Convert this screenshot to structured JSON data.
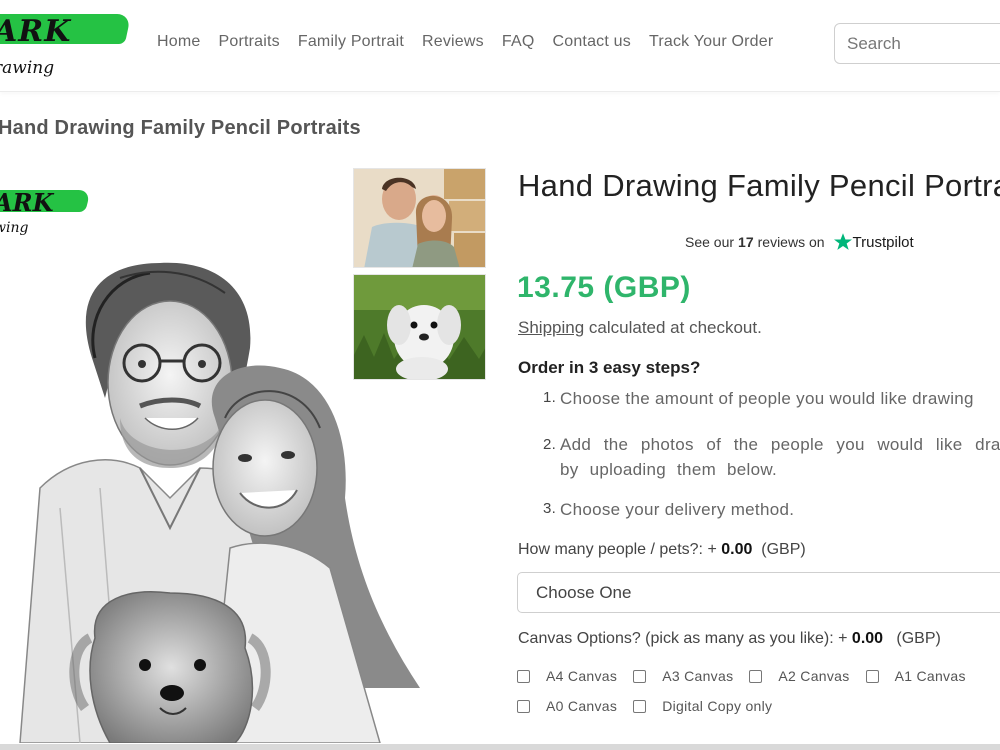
{
  "header": {
    "logo": {
      "word1": "ARK",
      "word2": "rawing"
    },
    "nav": [
      "Home",
      "Portraits",
      "Family Portrait",
      "Reviews",
      "FAQ",
      "Contact us",
      "Track Your Order"
    ],
    "search_placeholder": "Search"
  },
  "page_title": "Hand Drawing Family Pencil Portraits",
  "product": {
    "title": "Hand Drawing Family Pencil Portraits",
    "watermark": {
      "word1": "ARK",
      "word2": "wing"
    },
    "reviews": {
      "prefix": "See our",
      "count": "17",
      "suffix": "reviews on",
      "brand": "Trustpilot"
    },
    "price": "13.75  (GBP)",
    "shipping_link": "Shipping",
    "shipping_text": " calculated at checkout.",
    "steps_title": "Order in 3 easy steps?",
    "steps": [
      {
        "num": "1.",
        "text": "Choose the amount of people you would like drawing"
      },
      {
        "num": "2.",
        "text": "Add the photos of the people you would like drawn by uploading them below."
      },
      {
        "num": "3.",
        "text": "Choose your delivery method."
      }
    ],
    "people_option": {
      "label": "How many people / pets?: + ",
      "amount": "0.00",
      "currency": "  (GBP)"
    },
    "select_value": "Choose One",
    "canvas_option": {
      "label": "Canvas Options? (pick as many as you like): + ",
      "amount": "0.00",
      "currency": "   (GBP)"
    },
    "canvas_choices": [
      "A4 Canvas",
      "A3 Canvas",
      "A2 Canvas",
      "A1 Canvas",
      "A0 Canvas",
      "Digital Copy only"
    ]
  },
  "colors": {
    "brand_green": "#25c244",
    "price_green": "#2fb56b",
    "trustpilot_green": "#00b67a"
  },
  "icons": [
    "trustpilot-star-icon",
    "checkbox-icon"
  ]
}
